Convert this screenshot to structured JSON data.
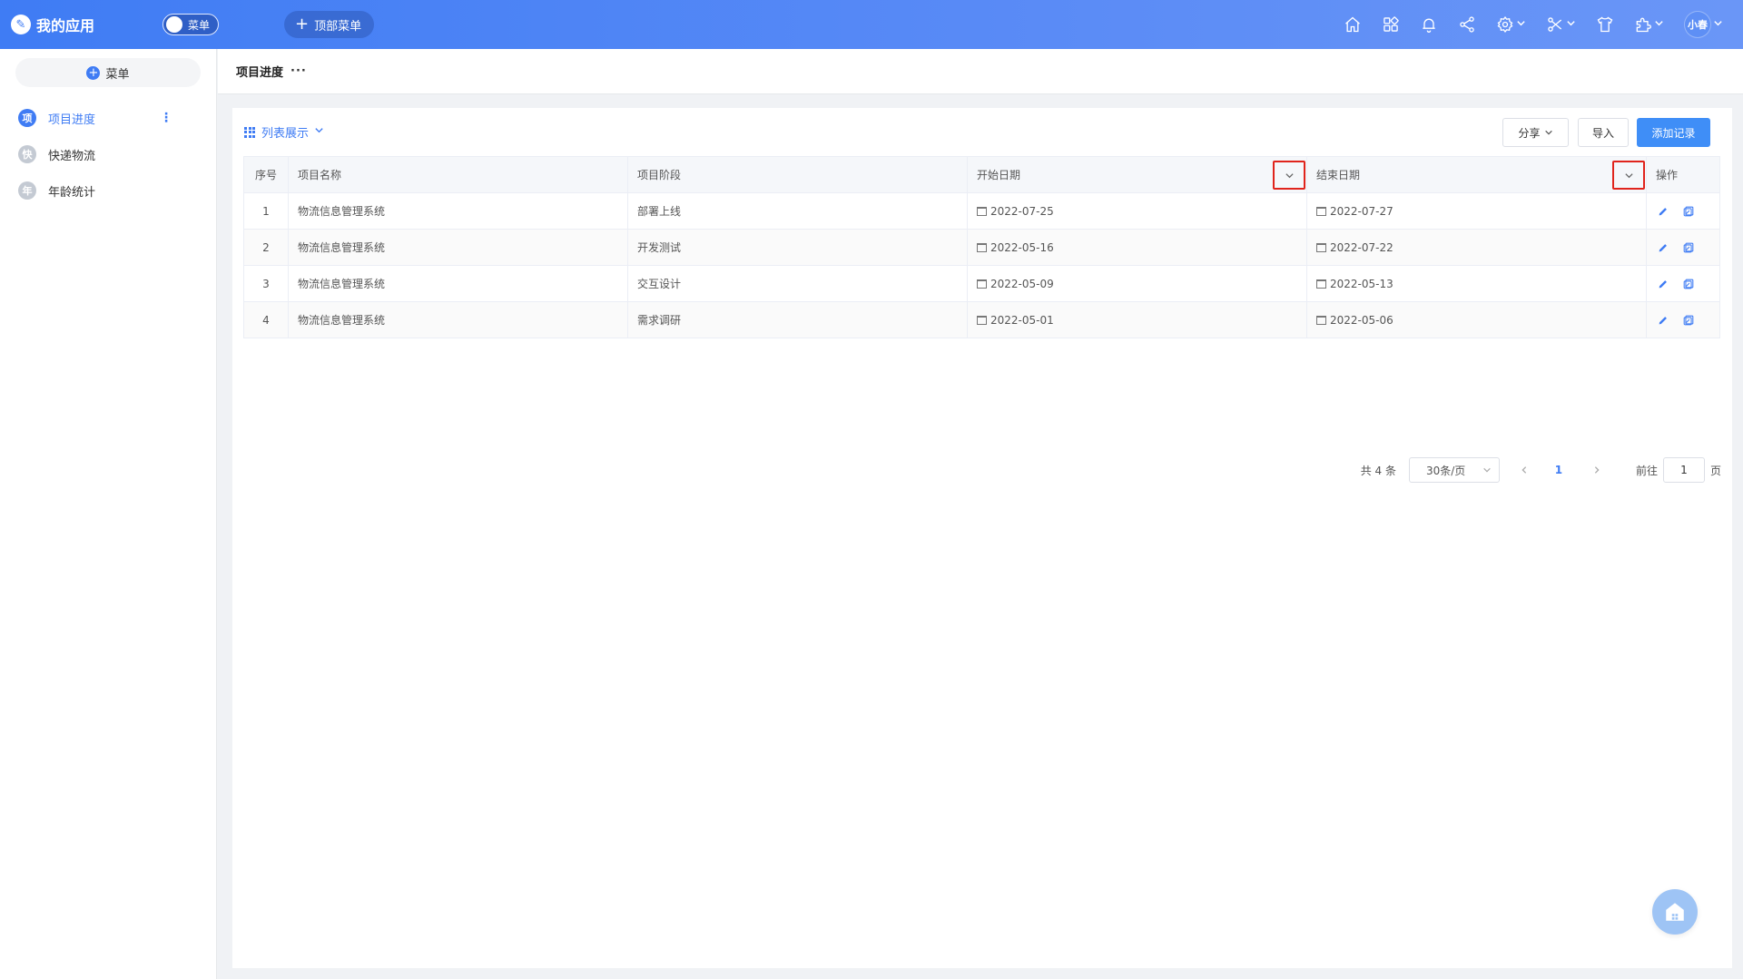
{
  "header": {
    "app_title": "我的应用",
    "logo_icon": "wrench-logo-icon",
    "menu_toggle_label": "菜单",
    "top_menu_button": "顶部菜单",
    "user_name": "小春",
    "icons": [
      "home-icon",
      "apps-icon",
      "bell-icon",
      "share-icon",
      "settings-icon",
      "tools-icon",
      "shirt-icon",
      "plugin-icon"
    ]
  },
  "sidebar": {
    "add_menu_label": "菜单",
    "items": [
      {
        "badge": "项",
        "label": "项目进度",
        "active": true
      },
      {
        "badge": "快",
        "label": "快递物流",
        "active": false
      },
      {
        "badge": "年",
        "label": "年龄统计",
        "active": false
      }
    ]
  },
  "breadcrumb": {
    "title": "项目进度",
    "more": "···"
  },
  "toolbar": {
    "view_label": "列表展示",
    "share_label": "分享",
    "import_label": "导入",
    "add_label": "添加记录"
  },
  "table": {
    "columns": [
      "序号",
      "项目名称",
      "项目阶段",
      "开始日期",
      "结束日期",
      "操作"
    ],
    "rows": [
      {
        "no": "1",
        "name": "物流信息管理系统",
        "stage": "部署上线",
        "start": "2022-07-25",
        "end": "2022-07-27"
      },
      {
        "no": "2",
        "name": "物流信息管理系统",
        "stage": "开发测试",
        "start": "2022-05-16",
        "end": "2022-07-22"
      },
      {
        "no": "3",
        "name": "物流信息管理系统",
        "stage": "交互设计",
        "start": "2022-05-09",
        "end": "2022-05-13"
      },
      {
        "no": "4",
        "name": "物流信息管理系统",
        "stage": "需求调研",
        "start": "2022-05-01",
        "end": "2022-05-06"
      }
    ]
  },
  "pagination": {
    "total": "共 4 条",
    "page_size": "30条/页",
    "current_page": "1",
    "goto_label": "前往",
    "goto_value": "1",
    "page_unit": "页"
  },
  "colors": {
    "accent": "#3f7cf4",
    "highlight_border": "#e0241c"
  }
}
